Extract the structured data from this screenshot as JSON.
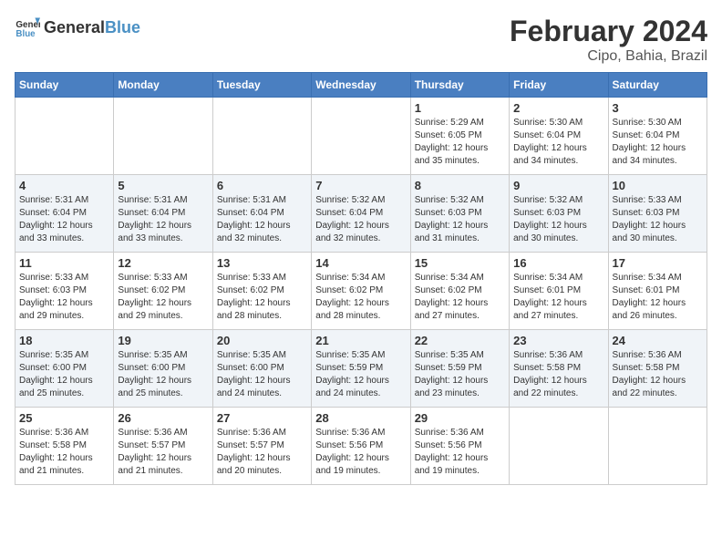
{
  "header": {
    "logo_general": "General",
    "logo_blue": "Blue",
    "month_title": "February 2024",
    "location": "Cipo, Bahia, Brazil"
  },
  "days_of_week": [
    "Sunday",
    "Monday",
    "Tuesday",
    "Wednesday",
    "Thursday",
    "Friday",
    "Saturday"
  ],
  "weeks": [
    [
      {
        "day": "",
        "info": ""
      },
      {
        "day": "",
        "info": ""
      },
      {
        "day": "",
        "info": ""
      },
      {
        "day": "",
        "info": ""
      },
      {
        "day": "1",
        "info": "Sunrise: 5:29 AM\nSunset: 6:05 PM\nDaylight: 12 hours\nand 35 minutes."
      },
      {
        "day": "2",
        "info": "Sunrise: 5:30 AM\nSunset: 6:04 PM\nDaylight: 12 hours\nand 34 minutes."
      },
      {
        "day": "3",
        "info": "Sunrise: 5:30 AM\nSunset: 6:04 PM\nDaylight: 12 hours\nand 34 minutes."
      }
    ],
    [
      {
        "day": "4",
        "info": "Sunrise: 5:31 AM\nSunset: 6:04 PM\nDaylight: 12 hours\nand 33 minutes."
      },
      {
        "day": "5",
        "info": "Sunrise: 5:31 AM\nSunset: 6:04 PM\nDaylight: 12 hours\nand 33 minutes."
      },
      {
        "day": "6",
        "info": "Sunrise: 5:31 AM\nSunset: 6:04 PM\nDaylight: 12 hours\nand 32 minutes."
      },
      {
        "day": "7",
        "info": "Sunrise: 5:32 AM\nSunset: 6:04 PM\nDaylight: 12 hours\nand 32 minutes."
      },
      {
        "day": "8",
        "info": "Sunrise: 5:32 AM\nSunset: 6:03 PM\nDaylight: 12 hours\nand 31 minutes."
      },
      {
        "day": "9",
        "info": "Sunrise: 5:32 AM\nSunset: 6:03 PM\nDaylight: 12 hours\nand 30 minutes."
      },
      {
        "day": "10",
        "info": "Sunrise: 5:33 AM\nSunset: 6:03 PM\nDaylight: 12 hours\nand 30 minutes."
      }
    ],
    [
      {
        "day": "11",
        "info": "Sunrise: 5:33 AM\nSunset: 6:03 PM\nDaylight: 12 hours\nand 29 minutes."
      },
      {
        "day": "12",
        "info": "Sunrise: 5:33 AM\nSunset: 6:02 PM\nDaylight: 12 hours\nand 29 minutes."
      },
      {
        "day": "13",
        "info": "Sunrise: 5:33 AM\nSunset: 6:02 PM\nDaylight: 12 hours\nand 28 minutes."
      },
      {
        "day": "14",
        "info": "Sunrise: 5:34 AM\nSunset: 6:02 PM\nDaylight: 12 hours\nand 28 minutes."
      },
      {
        "day": "15",
        "info": "Sunrise: 5:34 AM\nSunset: 6:02 PM\nDaylight: 12 hours\nand 27 minutes."
      },
      {
        "day": "16",
        "info": "Sunrise: 5:34 AM\nSunset: 6:01 PM\nDaylight: 12 hours\nand 27 minutes."
      },
      {
        "day": "17",
        "info": "Sunrise: 5:34 AM\nSunset: 6:01 PM\nDaylight: 12 hours\nand 26 minutes."
      }
    ],
    [
      {
        "day": "18",
        "info": "Sunrise: 5:35 AM\nSunset: 6:00 PM\nDaylight: 12 hours\nand 25 minutes."
      },
      {
        "day": "19",
        "info": "Sunrise: 5:35 AM\nSunset: 6:00 PM\nDaylight: 12 hours\nand 25 minutes."
      },
      {
        "day": "20",
        "info": "Sunrise: 5:35 AM\nSunset: 6:00 PM\nDaylight: 12 hours\nand 24 minutes."
      },
      {
        "day": "21",
        "info": "Sunrise: 5:35 AM\nSunset: 5:59 PM\nDaylight: 12 hours\nand 24 minutes."
      },
      {
        "day": "22",
        "info": "Sunrise: 5:35 AM\nSunset: 5:59 PM\nDaylight: 12 hours\nand 23 minutes."
      },
      {
        "day": "23",
        "info": "Sunrise: 5:36 AM\nSunset: 5:58 PM\nDaylight: 12 hours\nand 22 minutes."
      },
      {
        "day": "24",
        "info": "Sunrise: 5:36 AM\nSunset: 5:58 PM\nDaylight: 12 hours\nand 22 minutes."
      }
    ],
    [
      {
        "day": "25",
        "info": "Sunrise: 5:36 AM\nSunset: 5:58 PM\nDaylight: 12 hours\nand 21 minutes."
      },
      {
        "day": "26",
        "info": "Sunrise: 5:36 AM\nSunset: 5:57 PM\nDaylight: 12 hours\nand 21 minutes."
      },
      {
        "day": "27",
        "info": "Sunrise: 5:36 AM\nSunset: 5:57 PM\nDaylight: 12 hours\nand 20 minutes."
      },
      {
        "day": "28",
        "info": "Sunrise: 5:36 AM\nSunset: 5:56 PM\nDaylight: 12 hours\nand 19 minutes."
      },
      {
        "day": "29",
        "info": "Sunrise: 5:36 AM\nSunset: 5:56 PM\nDaylight: 12 hours\nand 19 minutes."
      },
      {
        "day": "",
        "info": ""
      },
      {
        "day": "",
        "info": ""
      }
    ]
  ]
}
